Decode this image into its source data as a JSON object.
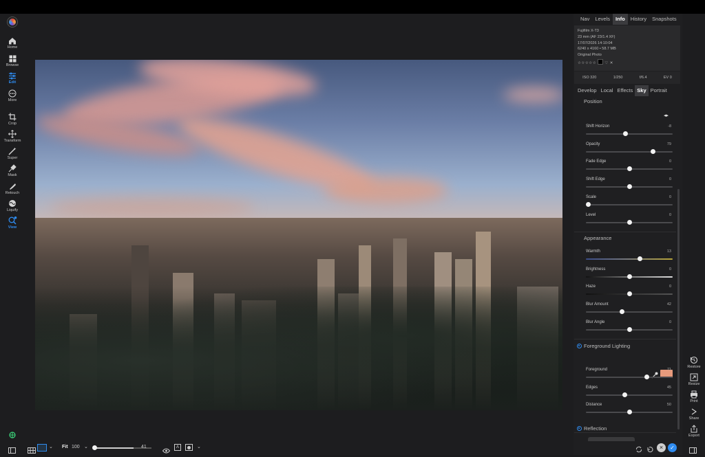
{
  "left_toolbar": [
    {
      "label": "Home",
      "icon": "home-icon"
    },
    {
      "label": "Browse",
      "icon": "browse-icon"
    },
    {
      "label": "Edit",
      "icon": "edit-icon",
      "active": true
    },
    {
      "label": "More",
      "icon": "more-icon"
    },
    {
      "label": "Crop",
      "icon": "crop-icon"
    },
    {
      "label": "Transform",
      "icon": "transform-icon"
    },
    {
      "label": "Super",
      "icon": "super-icon"
    },
    {
      "label": "Mask",
      "icon": "mask-icon"
    },
    {
      "label": "Retouch",
      "icon": "retouch-icon"
    },
    {
      "label": "Liquify",
      "icon": "liquify-icon"
    },
    {
      "label": "View",
      "icon": "view-icon",
      "active": true
    }
  ],
  "top_tabs": [
    "Nav",
    "Levels",
    "Info",
    "History",
    "Snapshots"
  ],
  "top_tabs_selected": "Info",
  "info": {
    "camera": "Fujifilm X-T3",
    "lens": "23 mm (AF 23/1.4 XF)",
    "datetime": "17/07/2026 14:10:04",
    "dimensions": "6240 x 4160  •  58.7 MB",
    "type": "Original Photo",
    "stars": "☆☆☆☆☆"
  },
  "exif": {
    "iso": "ISO 320",
    "shutter": "1/250",
    "aperture": "f/6.4",
    "ev": "EV 0"
  },
  "edit_tabs": [
    "Develop",
    "Local",
    "Effects",
    "Sky",
    "Portrait"
  ],
  "edit_tabs_selected": "Sky",
  "sections": {
    "position": "Position",
    "appearance": "Appearance",
    "foreground_lighting": "Foreground Lighting",
    "reflection": "Reflection"
  },
  "position_sliders": [
    {
      "name": "Shift Horizon",
      "value": "-8",
      "pos": 0.46
    },
    {
      "name": "Opacity",
      "value": "79",
      "pos": 0.77
    },
    {
      "name": "Fade Edge",
      "value": "0",
      "pos": 0.5
    },
    {
      "name": "Shift Edge",
      "value": "0",
      "pos": 0.5
    },
    {
      "name": "Scale",
      "value": "0",
      "pos": 0.03
    },
    {
      "name": "Level",
      "value": "0",
      "pos": 0.5
    }
  ],
  "appearance_sliders": [
    {
      "name": "Warmth",
      "value": "13",
      "pos": 0.62
    },
    {
      "name": "Brightness",
      "value": "0",
      "pos": 0.5
    },
    {
      "name": "Haze",
      "value": "0",
      "pos": 0.5
    },
    {
      "name": "Blur Amount",
      "value": "42",
      "pos": 0.42
    },
    {
      "name": "Blur Angle",
      "value": "0",
      "pos": 0.5
    }
  ],
  "foreground_sliders": [
    {
      "name": "Foreground",
      "value": "71",
      "pos": 0.7
    },
    {
      "name": "Edges",
      "value": "45",
      "pos": 0.45
    },
    {
      "name": "Distance",
      "value": "50",
      "pos": 0.5
    }
  ],
  "foreground_color": "#e79a7c",
  "right_actions": [
    {
      "label": "Restore",
      "icon": "restore-icon"
    },
    {
      "label": "Resize",
      "icon": "resize-icon"
    },
    {
      "label": "Print",
      "icon": "print-icon"
    },
    {
      "label": "Share",
      "icon": "share-icon"
    },
    {
      "label": "Export",
      "icon": "export-icon"
    }
  ],
  "bottom": {
    "fit_label": "Fit",
    "zoom_value": "100",
    "slider_value": "41",
    "zoom_fraction": 0.0
  }
}
